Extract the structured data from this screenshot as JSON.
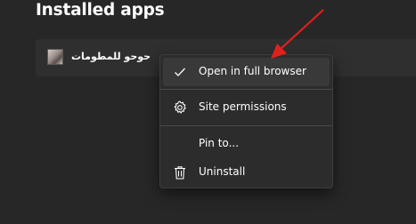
{
  "page": {
    "title": "Installed apps"
  },
  "app": {
    "name": "حوحو للمطومات",
    "thumb_icon": "app-thumbnail"
  },
  "menu": {
    "items": [
      {
        "label": "Open in full browser",
        "icon": "checkmark-icon",
        "active": true
      },
      {
        "label": "Site permissions",
        "icon": "gear-icon"
      },
      {
        "label": "Pin to...",
        "icon": ""
      },
      {
        "label": "Uninstall",
        "icon": "trash-icon"
      }
    ]
  },
  "colors": {
    "arrow": "#e0201c",
    "menu_bg": "#2c2c2c",
    "page_bg": "#272727"
  }
}
